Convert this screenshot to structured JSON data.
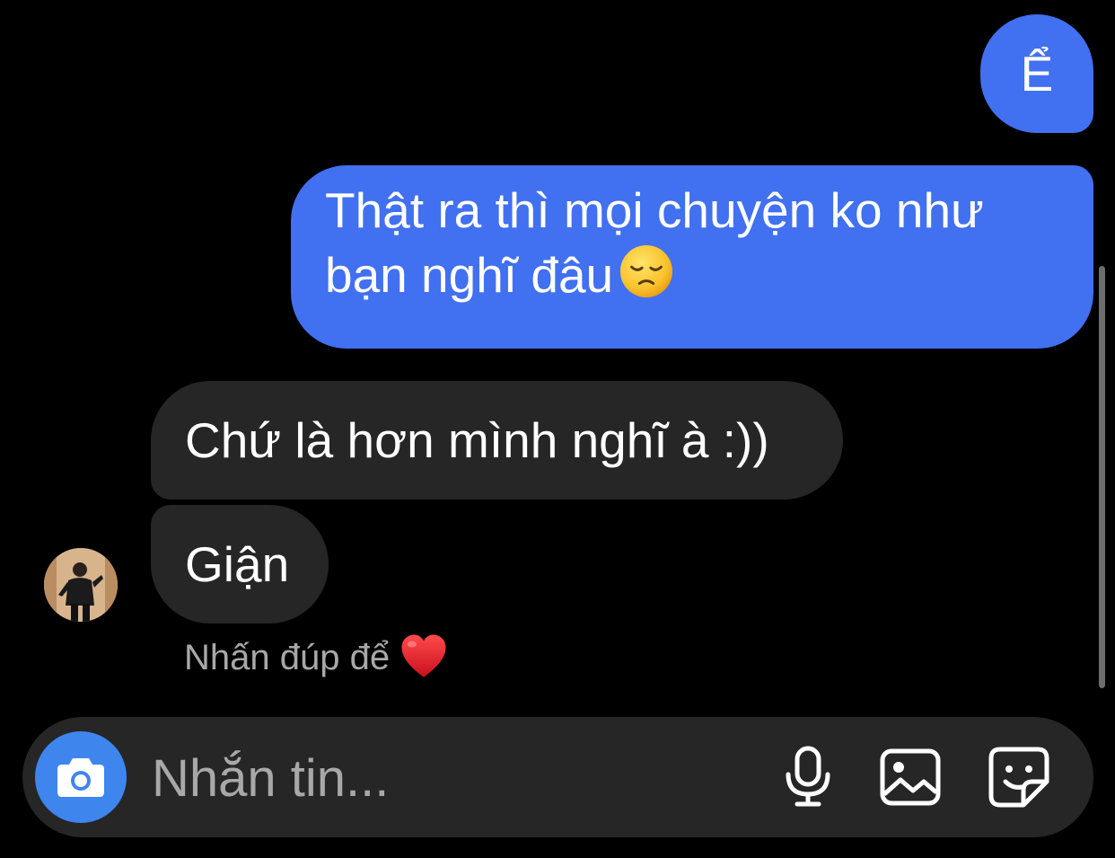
{
  "messages": [
    {
      "direction": "outgoing",
      "text": "Ể"
    },
    {
      "direction": "outgoing",
      "line1": "Thật ra thì mọi chuyện ko như",
      "line2": "bạn nghĩ đâu",
      "emoji": "disappointed-face"
    },
    {
      "direction": "incoming",
      "text": "Chứ là hơn mình nghĩ à :))"
    },
    {
      "direction": "incoming",
      "text": "Giận"
    }
  ],
  "reaction_hint": {
    "text": "Nhấn đúp để",
    "emoji": "red-heart"
  },
  "composer": {
    "placeholder": "Nhắn tin..."
  },
  "colors": {
    "background": "#000000",
    "outgoing_bubble": "#4170f0",
    "incoming_bubble": "#262626",
    "composer_bg": "#262626",
    "camera_button": "#3e85ee",
    "hint_text": "#a8a8a8"
  },
  "icons": [
    "camera-icon",
    "microphone-icon",
    "gallery-icon",
    "sticker-icon",
    "disappointed-face-emoji",
    "red-heart-emoji"
  ]
}
